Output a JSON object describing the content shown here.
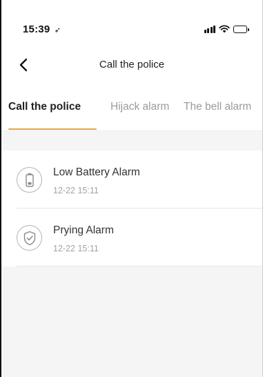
{
  "status_bar": {
    "time": "15:39",
    "location_glyph": "➶"
  },
  "nav": {
    "title": "Call the police",
    "back_glyph": "‹"
  },
  "tabs": [
    {
      "label": "Call the police",
      "active": true
    },
    {
      "label": "Hijack alarm",
      "active": false
    },
    {
      "label": "The bell alarm",
      "active": false
    }
  ],
  "alarms": [
    {
      "title": "Low Battery Alarm",
      "time": "12-22 15:11",
      "icon": "battery-icon"
    },
    {
      "title": "Prying Alarm",
      "time": "12-22 15:11",
      "icon": "shield-check-icon"
    }
  ],
  "colors": {
    "accent": "#f0a030",
    "inactive_tab": "#9b9b9b",
    "background_gray": "#f5f5f5",
    "secondary_text": "#a3a3a3"
  }
}
